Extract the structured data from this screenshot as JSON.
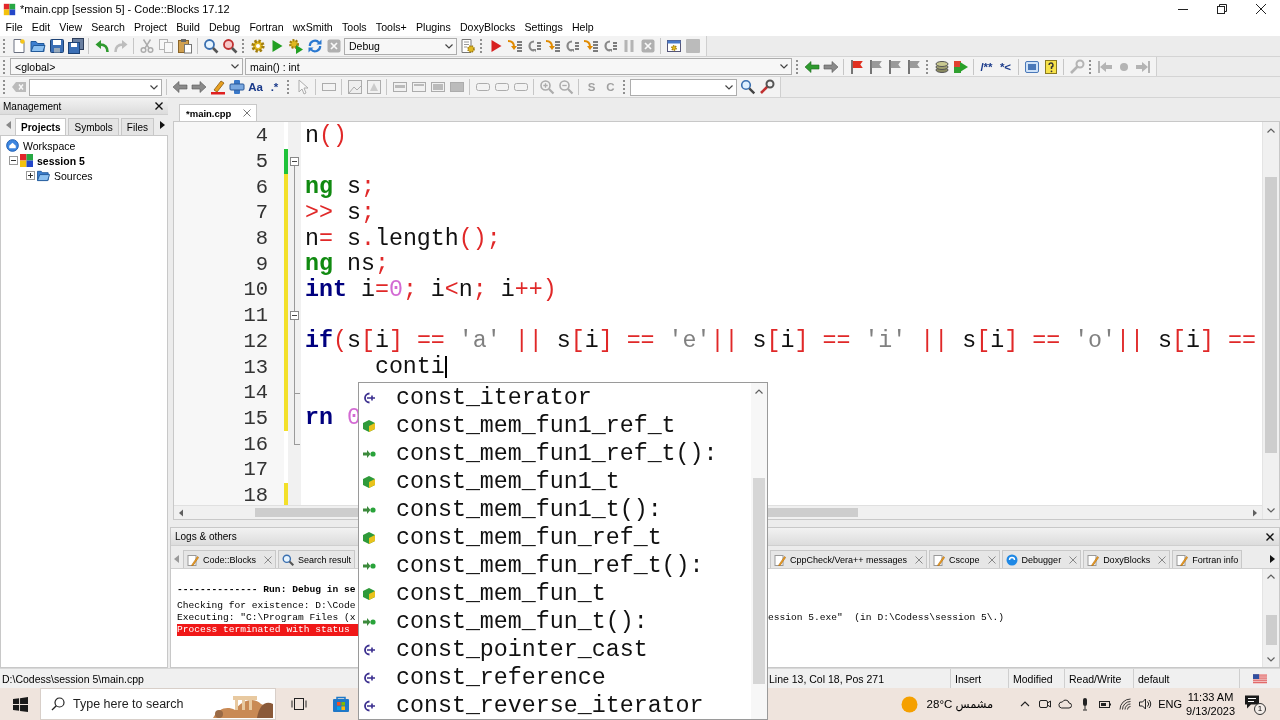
{
  "window": {
    "title": "*main.cpp [session 5] - Code::Blocks 17.12"
  },
  "menu": [
    "File",
    "Edit",
    "View",
    "Search",
    "Project",
    "Build",
    "Debug",
    "Fortran",
    "wxSmith",
    "Tools",
    "Tools+",
    "Plugins",
    "DoxyBlocks",
    "Settings",
    "Help"
  ],
  "toolbars": [
    {
      "items": [
        {
          "kind": "grip"
        },
        {
          "kind": "button",
          "disabled": false
        },
        {
          "kind": "button",
          "disabled": false
        },
        {
          "kind": "button",
          "disabled": false
        },
        {
          "kind": "button",
          "disabled": false
        },
        {
          "kind": "separator"
        },
        {
          "kind": "button",
          "disabled": false
        },
        {
          "kind": "button",
          "disabled": true
        },
        {
          "kind": "separator"
        },
        {
          "kind": "button",
          "disabled": true
        },
        {
          "kind": "button",
          "disabled": true
        },
        {
          "kind": "button",
          "disabled": false
        },
        {
          "kind": "separator"
        },
        {
          "kind": "button",
          "disabled": false
        },
        {
          "kind": "button",
          "disabled": false
        },
        {
          "kind": "grip"
        },
        {
          "kind": "button",
          "disabled": false
        },
        {
          "kind": "button",
          "disabled": false
        },
        {
          "kind": "button",
          "disabled": false
        },
        {
          "kind": "button",
          "disabled": false
        },
        {
          "kind": "button",
          "disabled": true
        },
        {
          "kind": "select",
          "value": "Debug"
        },
        {
          "kind": "button",
          "disabled": false
        },
        {
          "kind": "grip"
        },
        {
          "kind": "button",
          "disabled": false
        },
        {
          "kind": "button",
          "disabled": false
        },
        {
          "kind": "button",
          "disabled": false
        },
        {
          "kind": "button",
          "disabled": false
        },
        {
          "kind": "button",
          "disabled": false
        },
        {
          "kind": "button",
          "disabled": false
        },
        {
          "kind": "button",
          "disabled": false
        },
        {
          "kind": "button",
          "disabled": true
        },
        {
          "kind": "button",
          "disabled": true
        },
        {
          "kind": "separator"
        },
        {
          "kind": "button",
          "disabled": false
        },
        {
          "kind": "button",
          "disabled": true
        }
      ]
    },
    {
      "items": [
        {
          "kind": "grip"
        },
        {
          "kind": "select",
          "value": "<global>"
        },
        {
          "kind": "select",
          "value": "main() : int"
        },
        {
          "kind": "grip"
        },
        {
          "kind": "button",
          "disabled": false
        },
        {
          "kind": "button",
          "disabled": false
        },
        {
          "kind": "separator"
        },
        {
          "kind": "button",
          "disabled": false
        },
        {
          "kind": "button",
          "disabled": false
        },
        {
          "kind": "button",
          "disabled": false
        },
        {
          "kind": "button",
          "disabled": false
        },
        {
          "kind": "grip"
        },
        {
          "kind": "button",
          "disabled": false
        },
        {
          "kind": "button",
          "disabled": false
        },
        {
          "kind": "separator"
        },
        {
          "kind": "button",
          "label": "/**",
          "disabled": false
        },
        {
          "kind": "button",
          "label": "*<",
          "disabled": false
        },
        {
          "kind": "separator"
        },
        {
          "kind": "button",
          "disabled": false
        },
        {
          "kind": "button",
          "disabled": false
        },
        {
          "kind": "separator"
        },
        {
          "kind": "button",
          "disabled": true
        },
        {
          "kind": "grip"
        },
        {
          "kind": "button",
          "disabled": true
        },
        {
          "kind": "button",
          "disabled": true
        },
        {
          "kind": "button",
          "disabled": true
        }
      ]
    },
    {
      "items": [
        {
          "kind": "grip"
        },
        {
          "kind": "button",
          "disabled": true
        },
        {
          "kind": "select"
        },
        {
          "kind": "separator"
        },
        {
          "kind": "button",
          "disabled": false
        },
        {
          "kind": "button",
          "disabled": false
        },
        {
          "kind": "button",
          "disabled": false
        },
        {
          "kind": "button",
          "disabled": false
        },
        {
          "kind": "button",
          "label": "Aa",
          "disabled": false
        },
        {
          "kind": "button",
          "label": ".*",
          "disabled": false
        },
        {
          "kind": "grip"
        },
        {
          "kind": "button",
          "disabled": true
        },
        {
          "kind": "separator"
        },
        {
          "kind": "button",
          "disabled": true
        },
        {
          "kind": "separator"
        },
        {
          "kind": "button",
          "disabled": true
        },
        {
          "kind": "button",
          "disabled": true
        },
        {
          "kind": "separator"
        },
        {
          "kind": "button",
          "disabled": true
        },
        {
          "kind": "button",
          "disabled": true
        },
        {
          "kind": "button",
          "disabled": true
        },
        {
          "kind": "button",
          "disabled": true
        },
        {
          "kind": "separator"
        },
        {
          "kind": "button",
          "disabled": true
        },
        {
          "kind": "button",
          "disabled": true
        },
        {
          "kind": "button",
          "disabled": true
        },
        {
          "kind": "separator"
        },
        {
          "kind": "button",
          "disabled": true
        },
        {
          "kind": "button",
          "disabled": true
        },
        {
          "kind": "separator"
        },
        {
          "kind": "button",
          "label": "S",
          "disabled": true
        },
        {
          "kind": "button",
          "label": "C",
          "disabled": true
        },
        {
          "kind": "grip"
        },
        {
          "kind": "select"
        },
        {
          "kind": "button",
          "disabled": false
        },
        {
          "kind": "button",
          "disabled": false
        }
      ]
    }
  ],
  "management": {
    "title": "Management",
    "tabs": [
      {
        "label": "Projects",
        "selected": true
      },
      {
        "label": "Symbols",
        "selected": false
      },
      {
        "label": "Files",
        "selected": false
      }
    ],
    "tree": [
      {
        "label": "Workspace",
        "kind": "workspace",
        "active": false,
        "children": [
          {
            "label": "session 5",
            "kind": "project",
            "active": true,
            "expanded": true,
            "children": [
              {
                "label": "Sources",
                "kind": "folder",
                "active": false,
                "expanded": false
              }
            ]
          }
        ]
      }
    ]
  },
  "editor": {
    "tabs": [
      {
        "label": "*main.cpp",
        "selected": true
      }
    ],
    "lines": [
      {
        "number": "4",
        "tokens": [
          {
            "text": "n()",
            "kind": "plain"
          }
        ],
        "changed": false,
        "fold": false,
        "fold_end": false,
        "caret": false
      },
      {
        "number": "5",
        "changed": true,
        "saved": true,
        "fold": true,
        "fold_end": false,
        "caret": false
      },
      {
        "number": "6",
        "tokens": [
          {
            "text": "ng",
            "kind": "type"
          },
          {
            "text": " s;",
            "kind": "plain"
          }
        ],
        "changed": true,
        "saved": false,
        "fold": false,
        "fold_end": false,
        "caret": false
      },
      {
        "number": "7",
        "tokens": [
          {
            "text": ">> s;",
            "kind": "plain"
          }
        ],
        "changed": true,
        "saved": false,
        "fold": false,
        "fold_end": false,
        "caret": false
      },
      {
        "number": "8",
        "tokens": [
          {
            "text": "n= s.length();",
            "kind": "plain"
          }
        ],
        "changed": true,
        "saved": false,
        "fold": false,
        "fold_end": false,
        "caret": false
      },
      {
        "number": "9",
        "tokens": [
          {
            "text": "ng",
            "kind": "type"
          },
          {
            "text": " ns;",
            "kind": "plain"
          }
        ],
        "changed": true,
        "saved": false,
        "fold": false,
        "fold_end": false,
        "caret": false
      },
      {
        "number": "10",
        "tokens": [
          {
            "text": "int",
            "kind": "keyword"
          },
          {
            "text": " i=0; i<n; i++)",
            "kind": "plain"
          }
        ],
        "changed": true,
        "saved": false,
        "fold": false,
        "fold_end": false,
        "caret": false
      },
      {
        "number": "11",
        "changed": true,
        "saved": false,
        "fold": true,
        "fold_end": false,
        "caret": false
      },
      {
        "number": "12",
        "tokens": [
          {
            "text": "if",
            "kind": "keyword"
          },
          {
            "text": "(s[i] == 'a' || s[i] == 'e'|| s[i] == 'i' || s[i] == 'o'|| s[i] ==",
            "kind": "plain"
          }
        ],
        "changed": true,
        "saved": false,
        "fold": false,
        "fold_end": false,
        "caret": false
      },
      {
        "number": "13",
        "tokens": [
          {
            "text": "     conti",
            "kind": "plain"
          }
        ],
        "changed": true,
        "saved": false,
        "fold": false,
        "fold_end": false,
        "caret": true
      },
      {
        "number": "14",
        "changed": true,
        "saved": false,
        "fold": false,
        "fold_end": true,
        "caret": false
      },
      {
        "number": "15",
        "tokens": [
          {
            "text": "rn",
            "kind": "keyword"
          },
          {
            "text": " 0",
            "kind": "plain"
          }
        ],
        "changed": true,
        "saved": false,
        "fold": false,
        "fold_end": false,
        "caret": false
      },
      {
        "number": "16",
        "changed": false,
        "fold": false,
        "fold_end": true,
        "caret": false
      },
      {
        "number": "17",
        "changed": false,
        "fold": false,
        "fold_end": false,
        "caret": false
      },
      {
        "number": "18",
        "changed": true,
        "saved": false,
        "fold": false,
        "fold_end": false,
        "caret": false
      }
    ]
  },
  "autocomplete": {
    "items": [
      {
        "text": "const_iterator",
        "kind": "typedef",
        "selected": false
      },
      {
        "text": "const_mem_fun1_ref_t",
        "kind": "class",
        "selected": false
      },
      {
        "text": "const_mem_fun1_ref_t():",
        "kind": "function",
        "selected": false
      },
      {
        "text": "const_mem_fun1_t",
        "kind": "class",
        "selected": false
      },
      {
        "text": "const_mem_fun1_t():",
        "kind": "function",
        "selected": false
      },
      {
        "text": "const_mem_fun_ref_t",
        "kind": "class",
        "selected": false
      },
      {
        "text": "const_mem_fun_ref_t():",
        "kind": "function",
        "selected": false
      },
      {
        "text": "const_mem_fun_t",
        "kind": "class",
        "selected": false
      },
      {
        "text": "const_mem_fun_t():",
        "kind": "function",
        "selected": false
      },
      {
        "text": "const_pointer_cast",
        "kind": "typedef",
        "selected": false
      },
      {
        "text": "const_reference",
        "kind": "typedef",
        "selected": false
      },
      {
        "text": "const_reverse_iterator",
        "kind": "typedef",
        "selected": false
      }
    ]
  },
  "logs": {
    "title": "Logs & others",
    "tabs": [
      {
        "label": "Code::Blocks",
        "kind": "log",
        "closable": true,
        "selected": false
      },
      {
        "label": "Search result",
        "kind": "search",
        "closable": false,
        "selected": false
      },
      {
        "label": "CppCheck/Vera++ messages",
        "kind": "log",
        "closable": true,
        "selected": false
      },
      {
        "label": "Cscope",
        "kind": "log",
        "closable": true,
        "selected": false
      },
      {
        "label": "Debugger",
        "kind": "debugger",
        "closable": true,
        "selected": false
      },
      {
        "label": "DoxyBlocks",
        "kind": "log",
        "closable": true,
        "selected": false
      },
      {
        "label": "Fortran info",
        "kind": "log",
        "closable": false,
        "selected": false
      }
    ],
    "lines": [
      {
        "text": "-------------- Run: Debug in se",
        "kind": "header"
      },
      {
        "text": "Checking for existence: D:\\Code",
        "kind": "info"
      },
      {
        "text": "Executing: \"C:\\Program Files (x",
        "kind": "info",
        "tail": "ession 5.exe\"  (in D:\\Codess\\session 5\\.)"
      },
      {
        "text": "Process terminated with status",
        "kind": "error"
      }
    ]
  },
  "status_bar": {
    "path": "D:\\Codess\\session 5\\main.cpp",
    "fields": [
      "Line 13, Col 18, Pos 271",
      "Insert",
      "Modified",
      "Read/Write",
      "default"
    ]
  },
  "taskbar": {
    "search": {
      "placeholder": "Type here to search"
    },
    "weather": "28°C مشمس",
    "language": "ENG",
    "time": "11:33 AM",
    "date": "9/13/2023",
    "notification_count": "1"
  }
}
